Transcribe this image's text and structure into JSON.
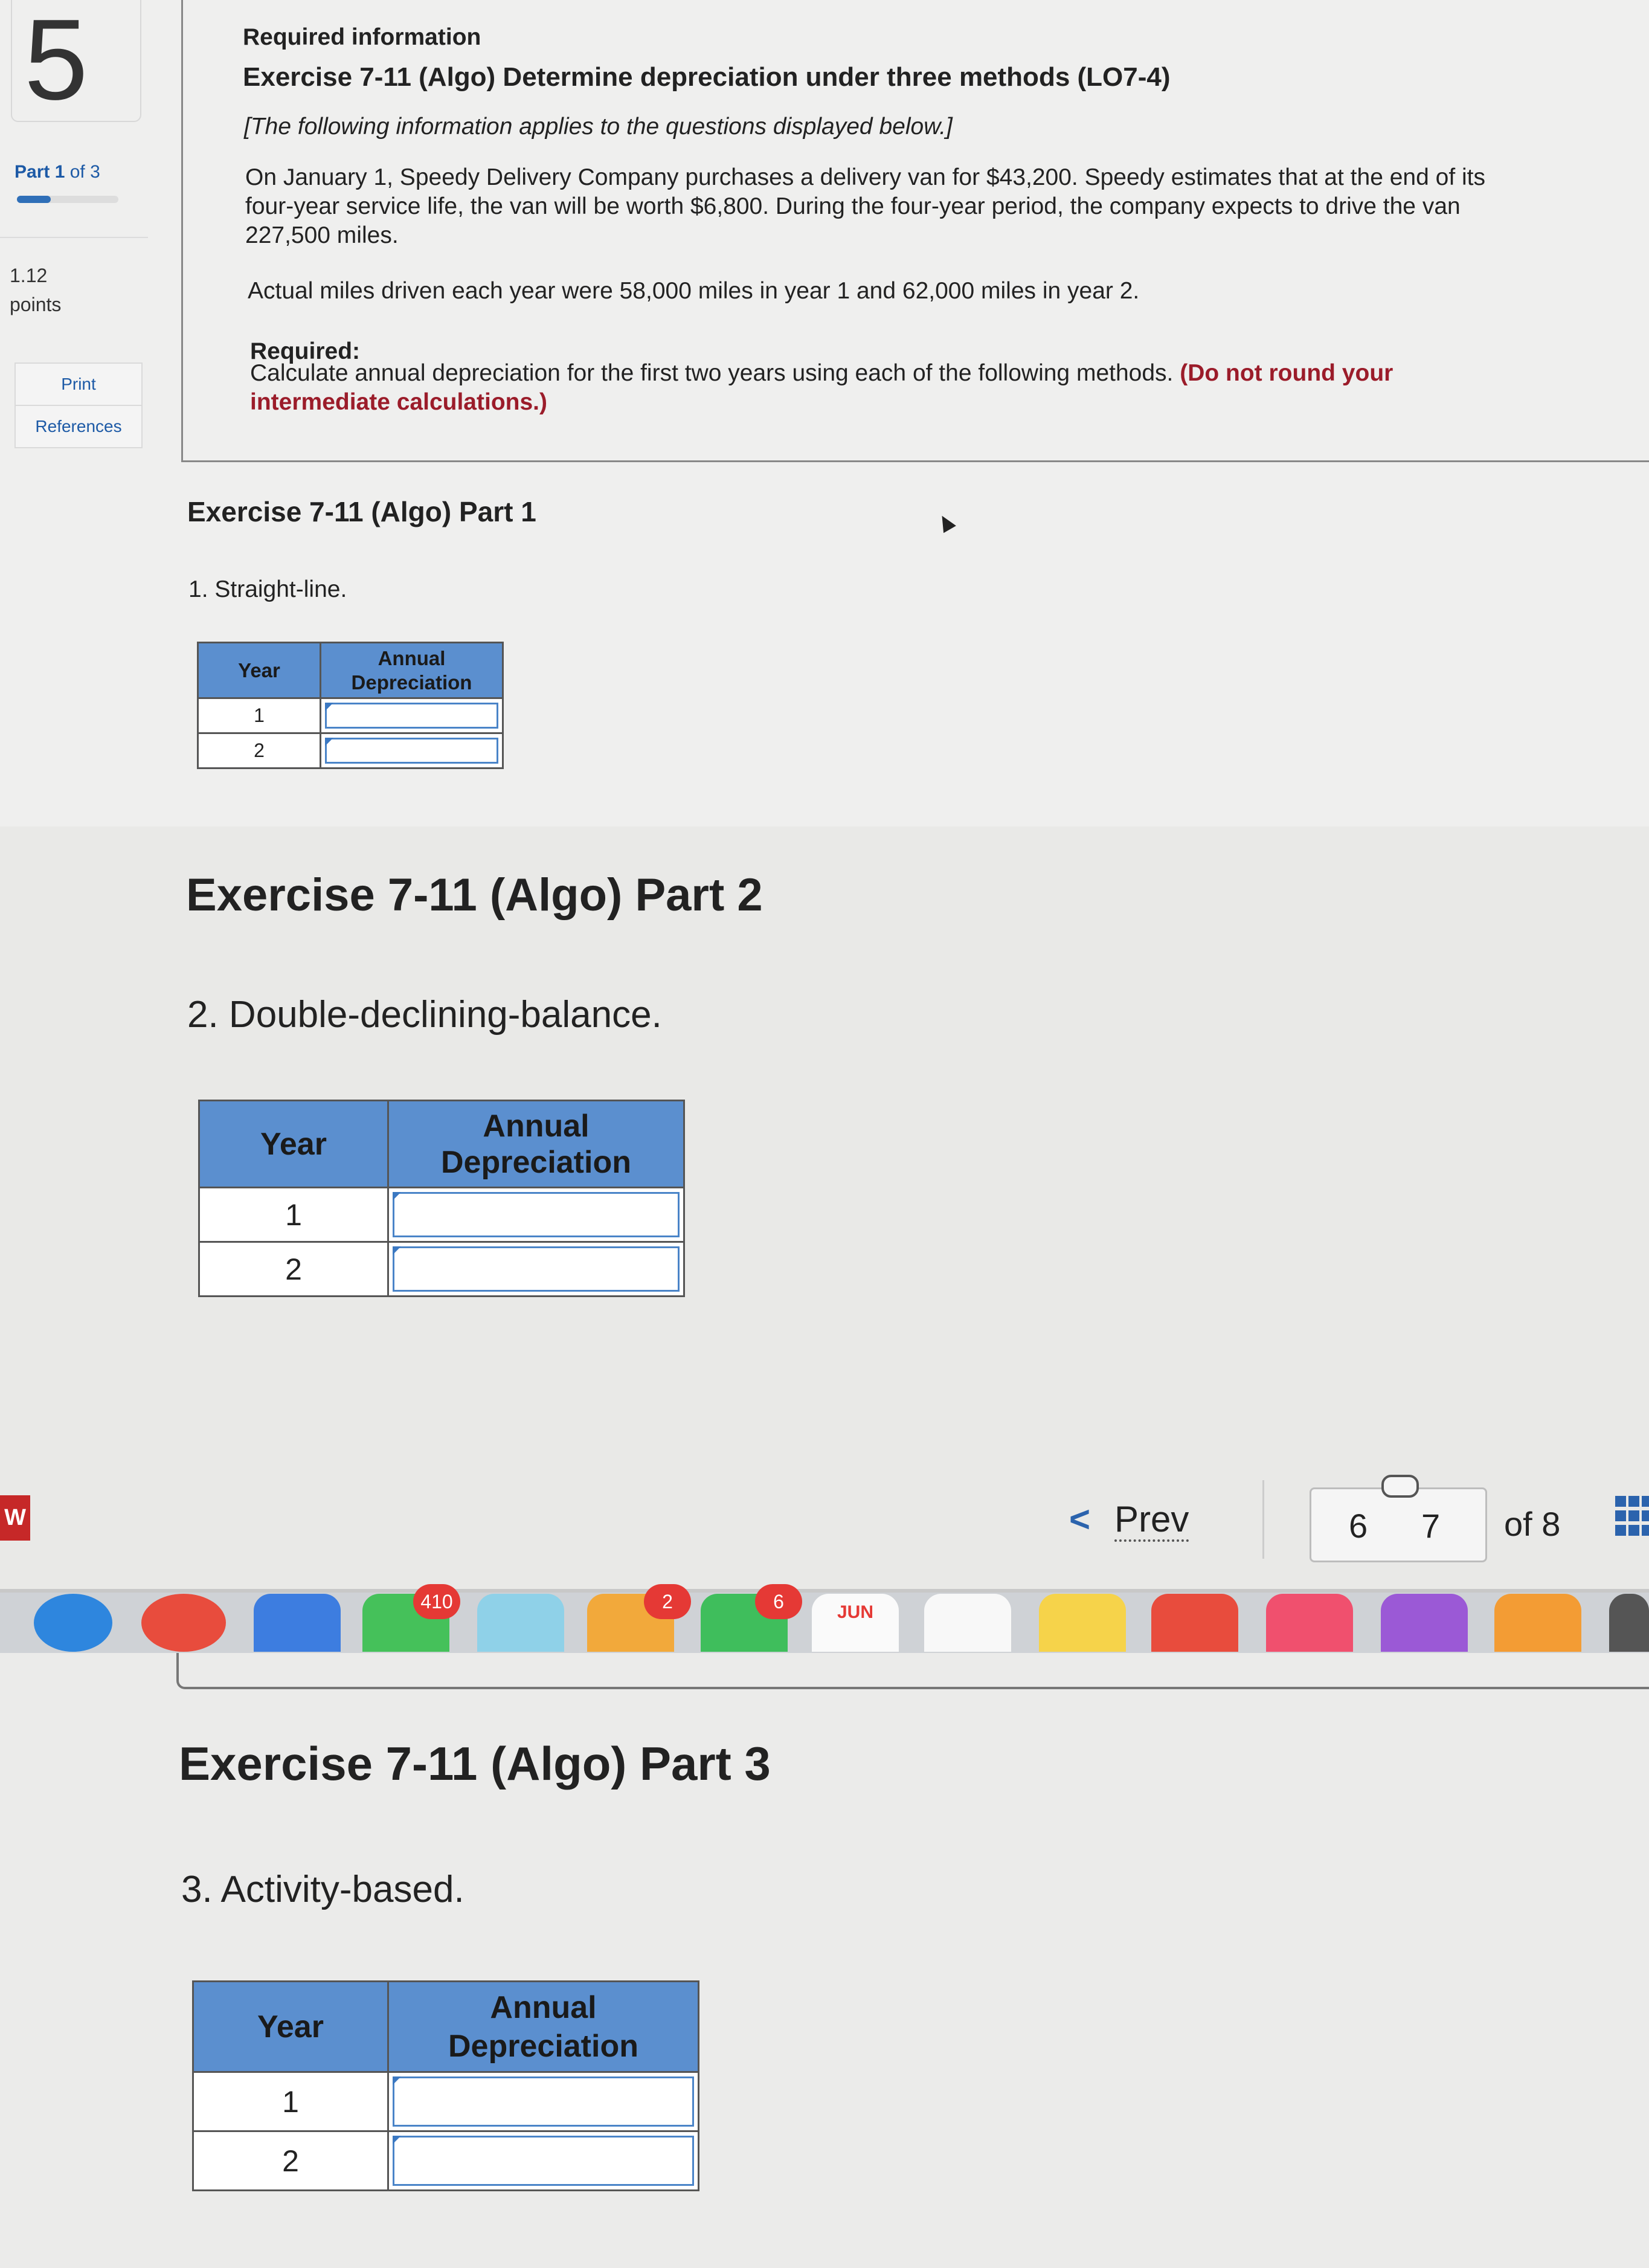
{
  "sidebar": {
    "question_number": "5",
    "part_label_bold": "Part 1",
    "part_label_rest": " of 3",
    "progress_fraction": 0.333,
    "points_value": "1.12",
    "points_label": "points",
    "print_label": "Print",
    "references_label": "References"
  },
  "info": {
    "required_information": "Required information",
    "exercise_title": "Exercise 7-11 (Algo) Determine depreciation under three methods (LO7-4)",
    "applies_note": "[The following information applies to the questions displayed below.]",
    "paragraph_line1": "On January 1, Speedy Delivery Company purchases a delivery van for $43,200. Speedy estimates that at the end of its",
    "paragraph_line2": "four-year service life, the van will be worth $6,800. During the four-year period, the company expects to drive the van",
    "paragraph_line3": "227,500 miles.",
    "actual_miles": "Actual miles driven each year were 58,000 miles in year 1 and 62,000 miles in year 2.",
    "required_label": "Required:",
    "required_text": "Calculate annual depreciation for the first two years using each of the following methods.",
    "required_red_line1": "(Do not round your",
    "required_red_line2": "intermediate calculations.)"
  },
  "parts": [
    {
      "heading": "Exercise 7-11 (Algo) Part 1",
      "method": "1. Straight-line.",
      "col_year": "Year",
      "col_dep_line1": "Annual",
      "col_dep_line2": "Depreciation",
      "rows": [
        "1",
        "2"
      ]
    },
    {
      "heading": "Exercise 7-11 (Algo) Part 2",
      "method": "2. Double-declining-balance.",
      "col_year": "Year",
      "col_dep_line1": "Annual",
      "col_dep_line2": "Depreciation",
      "rows": [
        "1",
        "2"
      ]
    },
    {
      "heading": "Exercise 7-11 (Algo) Part 3",
      "method": "3. Activity-based.",
      "col_year": "Year",
      "col_dep_line1": "Annual",
      "col_dep_line2": "Depreciation",
      "rows": [
        "1",
        "2"
      ]
    }
  ],
  "navigation": {
    "left_edge_letter": "W",
    "prev_label": "Prev",
    "page_prev": "6",
    "page_current": "7",
    "of_label": "of 8"
  },
  "dock": {
    "badge_mail": "410",
    "badge_photos": "2",
    "badge_messages": "6",
    "calendar_month": "JUN"
  },
  "colors": {
    "table_header": "#5b8fcf",
    "link_blue": "#1d5aa6",
    "required_red": "#9b1c2a"
  }
}
